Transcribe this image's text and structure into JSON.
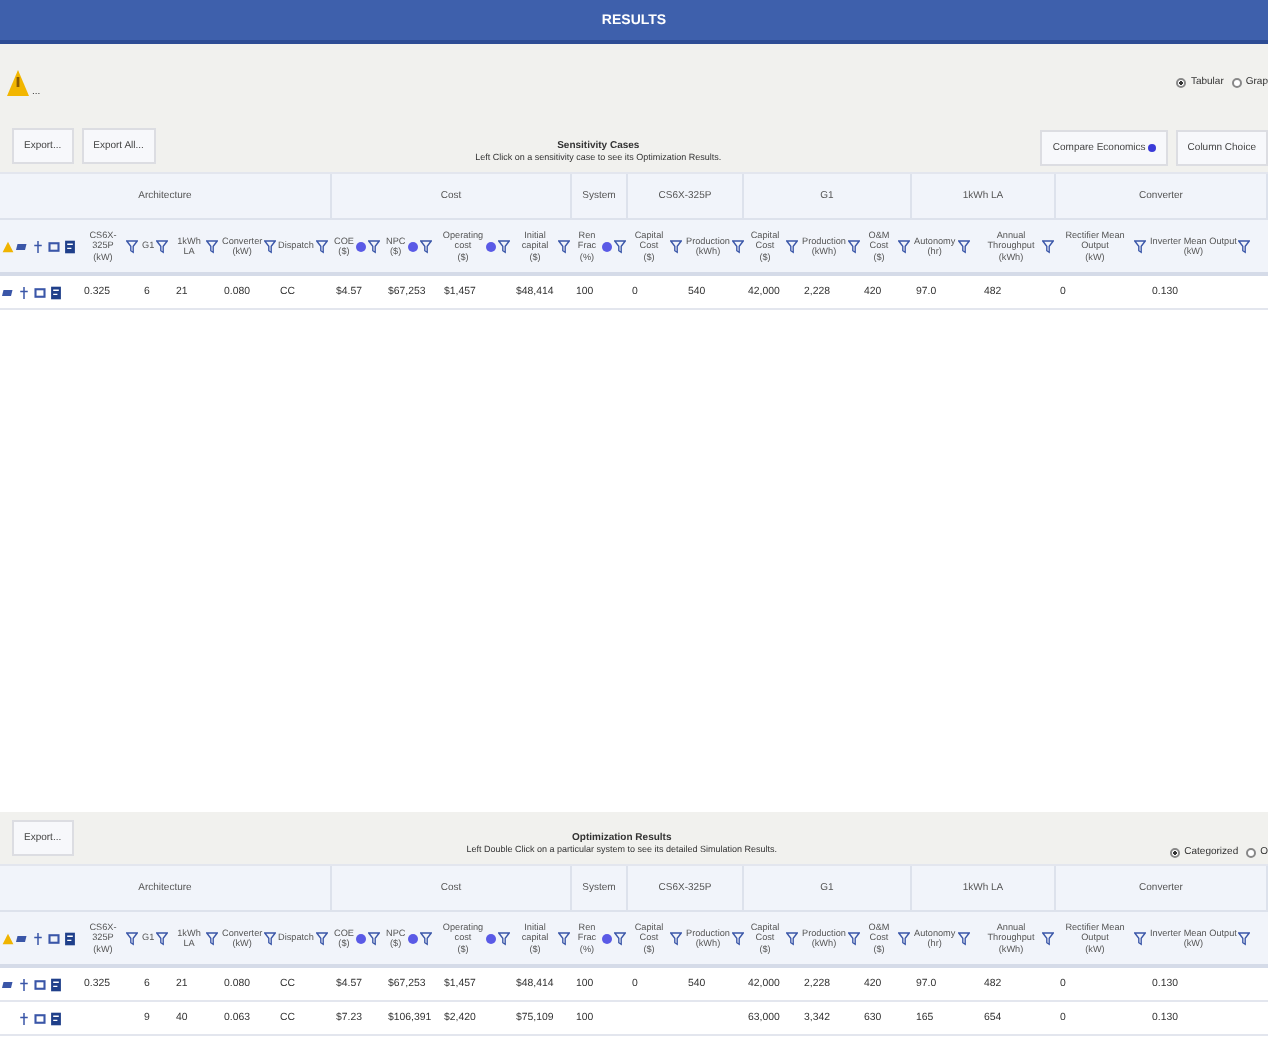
{
  "window": {
    "title": "RESULTS"
  },
  "toolbar": {
    "warning_label": "...",
    "view_options": [
      {
        "label": "Tabular",
        "selected": true
      },
      {
        "label": "Grap",
        "selected": false
      }
    ]
  },
  "sensitivity": {
    "title": "Sensitivity Cases",
    "subtitle": "Left Click on a sensitivity case to see its Optimization Results.",
    "buttons_left": [
      "Export...",
      "Export All..."
    ],
    "buttons_right": [
      {
        "label": "Compare Economics",
        "dot": true
      },
      {
        "label": "Column Choice",
        "dot": false
      }
    ],
    "groups": [
      "Architecture",
      "Cost",
      "System",
      "CS6X-325P",
      "G1",
      "1kWh LA",
      "Converter"
    ],
    "columns": [
      {
        "label": "CS6X-325P",
        "unit": "(kW)",
        "dot": false
      },
      {
        "label": "G1",
        "dot": false
      },
      {
        "label": "1kWh LA",
        "dot": false
      },
      {
        "label": "Converter",
        "unit": "(kW)",
        "dot": false
      },
      {
        "label": "Dispatch",
        "dot": false
      },
      {
        "label": "COE",
        "unit": "($)",
        "dot": true
      },
      {
        "label": "NPC",
        "unit": "($)",
        "dot": true
      },
      {
        "label": "Operating cost",
        "unit": "($)",
        "dot": true
      },
      {
        "label": "Initial capital",
        "unit": "($)",
        "dot": false
      },
      {
        "label": "Ren Frac",
        "unit": "(%)",
        "dot": true
      },
      {
        "label": "Capital Cost",
        "unit": "($)",
        "dot": false
      },
      {
        "label": "Production",
        "unit": "(kWh)",
        "dot": false
      },
      {
        "label": "Capital Cost",
        "unit": "($)",
        "dot": false
      },
      {
        "label": "Production",
        "unit": "(kWh)",
        "dot": false
      },
      {
        "label": "O&M Cost",
        "unit": "($)",
        "dot": false
      },
      {
        "label": "Autonomy",
        "unit": "(hr)",
        "dot": false
      },
      {
        "label": "Annual Throughput",
        "unit": "(kWh)",
        "dot": false
      },
      {
        "label": "Rectifier Mean Output",
        "unit": "(kW)",
        "dot": false
      },
      {
        "label": "Inverter Mean Output",
        "unit": "(kW)",
        "dot": false
      }
    ],
    "rows": [
      {
        "pv": true,
        "cells": [
          "0.325",
          "6",
          "21",
          "0.080",
          "CC",
          "$4.57",
          "$67,253",
          "$1,457",
          "$48,414",
          "100",
          "0",
          "540",
          "42,000",
          "2,228",
          "420",
          "97.0",
          "482",
          "0",
          "0.130"
        ]
      }
    ]
  },
  "optimization": {
    "title": "Optimization Results",
    "subtitle": "Left Double Click on a particular system to see its detailed Simulation Results.",
    "buttons_left": [
      "Export..."
    ],
    "view_options": [
      {
        "label": "Categorized",
        "selected": true
      },
      {
        "label": "O",
        "selected": false
      }
    ],
    "groups": [
      "Architecture",
      "Cost",
      "System",
      "CS6X-325P",
      "G1",
      "1kWh LA",
      "Converter"
    ],
    "columns": [
      {
        "label": "CS6X-325P",
        "unit": "(kW)",
        "dot": false
      },
      {
        "label": "G1",
        "dot": false
      },
      {
        "label": "1kWh LA",
        "dot": false
      },
      {
        "label": "Converter",
        "unit": "(kW)",
        "dot": false
      },
      {
        "label": "Dispatch",
        "dot": false
      },
      {
        "label": "COE",
        "unit": "($)",
        "dot": true
      },
      {
        "label": "NPC",
        "unit": "($)",
        "dot": true
      },
      {
        "label": "Operating cost",
        "unit": "($)",
        "dot": true
      },
      {
        "label": "Initial capital",
        "unit": "($)",
        "dot": false
      },
      {
        "label": "Ren Frac",
        "unit": "(%)",
        "dot": true
      },
      {
        "label": "Capital Cost",
        "unit": "($)",
        "dot": false
      },
      {
        "label": "Production",
        "unit": "(kWh)",
        "dot": false
      },
      {
        "label": "Capital Cost",
        "unit": "($)",
        "dot": false
      },
      {
        "label": "Production",
        "unit": "(kWh)",
        "dot": false
      },
      {
        "label": "O&M Cost",
        "unit": "($)",
        "dot": false
      },
      {
        "label": "Autonomy",
        "unit": "(hr)",
        "dot": false
      },
      {
        "label": "Annual Throughput",
        "unit": "(kWh)",
        "dot": false
      },
      {
        "label": "Rectifier Mean Output",
        "unit": "(kW)",
        "dot": false
      },
      {
        "label": "Inverter Mean Output",
        "unit": "(kW)",
        "dot": false
      }
    ],
    "rows": [
      {
        "pv": true,
        "cells": [
          "0.325",
          "6",
          "21",
          "0.080",
          "CC",
          "$4.57",
          "$67,253",
          "$1,457",
          "$48,414",
          "100",
          "0",
          "540",
          "42,000",
          "2,228",
          "420",
          "97.0",
          "482",
          "0",
          "0.130"
        ]
      },
      {
        "pv": false,
        "cells": [
          "",
          "9",
          "40",
          "0.063",
          "CC",
          "$7.23",
          "$106,391",
          "$2,420",
          "$75,109",
          "100",
          "",
          "",
          "63,000",
          "3,342",
          "630",
          "165",
          "654",
          "0",
          "0.130"
        ]
      }
    ]
  }
}
